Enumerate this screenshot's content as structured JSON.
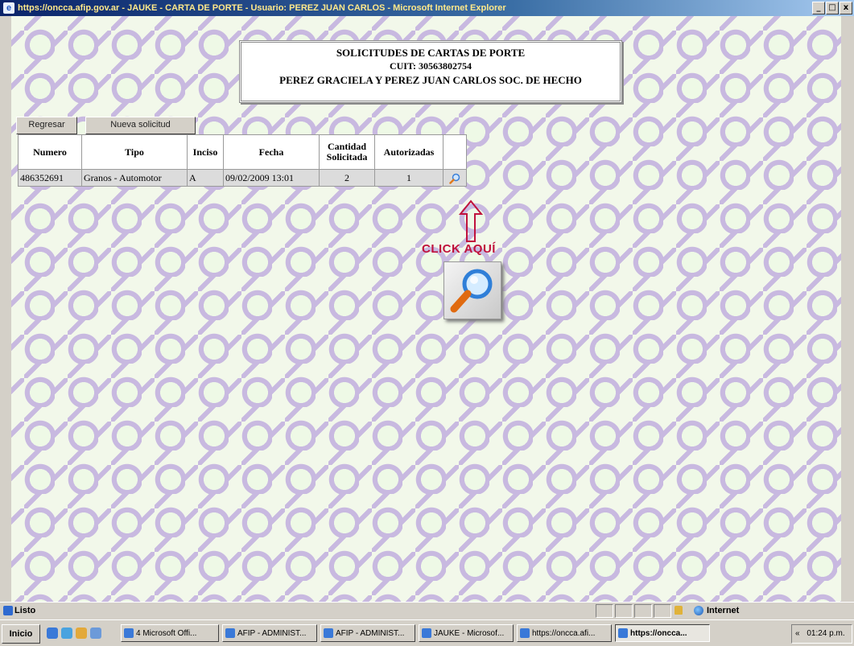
{
  "window": {
    "title": "https://oncca.afip.gov.ar - JAUKE - CARTA DE PORTE - Usuario: PEREZ JUAN CARLOS - Microsoft Internet Explorer",
    "minimize": "_",
    "maximize": "□",
    "close": "x"
  },
  "header": {
    "title": "SOLICITUDES DE CARTAS DE PORTE",
    "cuit": "CUIT: 30563802754",
    "company": "PEREZ GRACIELA Y PEREZ JUAN CARLOS SOC. DE HECHO"
  },
  "toolbar": {
    "back_label": "Regresar",
    "new_label": "Nueva solicitud"
  },
  "table": {
    "headers": {
      "numero": "Numero",
      "tipo": "Tipo",
      "inciso": "Inciso",
      "fecha": "Fecha",
      "cantidad_1": "Cantidad",
      "cantidad_2": "Solicitada",
      "autorizadas": "Autorizadas"
    },
    "rows": [
      {
        "numero": "486352691",
        "tipo": "Granos - Automotor",
        "inciso": "A",
        "fecha": "09/02/2009 13:01",
        "cantidad": "2",
        "autorizadas": "1"
      }
    ]
  },
  "annotation": {
    "label": "CLICK AQUÍ",
    "color": "#c0123d"
  },
  "statusbar": {
    "text": "Listo",
    "zone": "Internet"
  },
  "taskbar": {
    "start": "Inicio",
    "tasks": [
      "4 Microsoft Offi...",
      "AFIP - ADMINIST...",
      "AFIP - ADMINIST...",
      "JAUKE - Microsof...",
      "https://oncca.afi...",
      "https://oncca..."
    ],
    "clock": "01:24 p.m."
  }
}
